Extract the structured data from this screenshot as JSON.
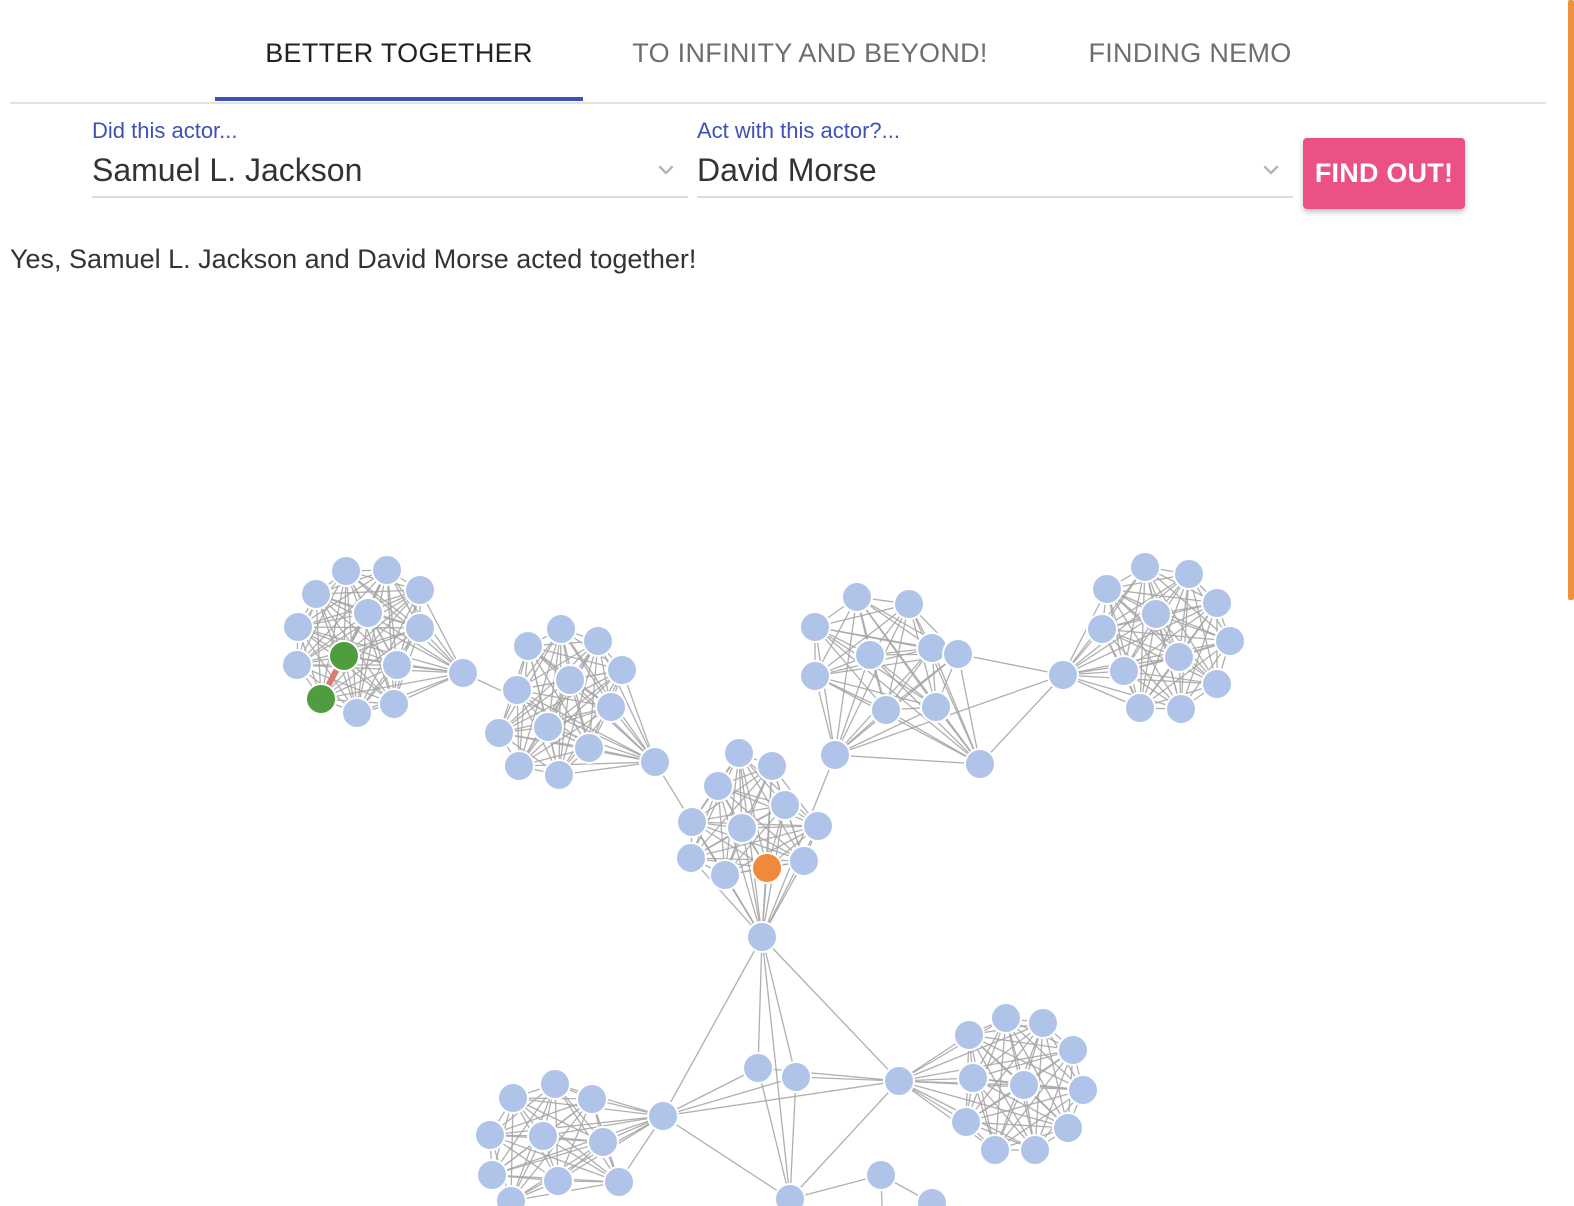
{
  "tabs": [
    {
      "label": "BETTER TOGETHER",
      "active": true
    },
    {
      "label": "TO INFINITY AND BEYOND!",
      "active": false
    },
    {
      "label": "FINDING NEMO",
      "active": false
    }
  ],
  "form": {
    "actor1": {
      "label": "Did this actor...",
      "value": "Samuel L. Jackson"
    },
    "actor2": {
      "label": "Act with this actor?...",
      "value": "David Morse"
    },
    "button_label": "FIND OUT!"
  },
  "result_text": "Yes, Samuel L. Jackson and David Morse acted together!",
  "colors": {
    "accent": "#3f51b5",
    "button": "#ec5186",
    "node_default": "#b0c4ea",
    "node_selected": "#4f9d3e",
    "node_highlight": "#f08a3a",
    "edge": "#a6a6a6",
    "path_edge": "#d77c73"
  }
}
